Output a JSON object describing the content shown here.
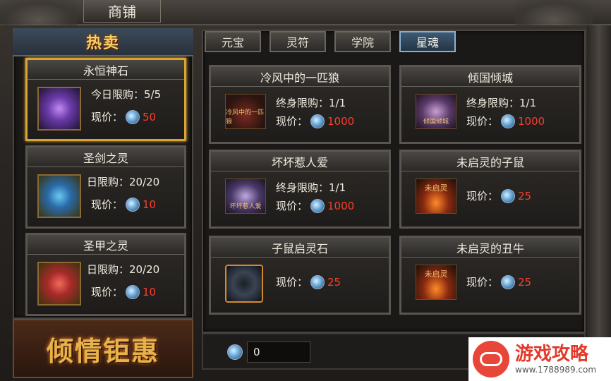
{
  "window": {
    "title": "商铺"
  },
  "hot": {
    "label": "热卖",
    "slogan": "倾情钜惠"
  },
  "left_items": [
    {
      "name": "永恒神石",
      "limit": "今日限购：5/5",
      "price_label": "现价：",
      "price": "50",
      "icon": "purple-crystal-icon"
    },
    {
      "name": "圣剑之灵",
      "limit": "日限购：20/20",
      "price_label": "现价：",
      "price": "10",
      "icon": "blue-orb-icon"
    },
    {
      "name": "圣甲之灵",
      "limit": "日限购：20/20",
      "price_label": "现价：",
      "price": "10",
      "icon": "red-orb-icon"
    }
  ],
  "tabs": [
    {
      "label": "元宝"
    },
    {
      "label": "灵符"
    },
    {
      "label": "学院"
    },
    {
      "label": "星魂"
    }
  ],
  "active_tab": "星魂",
  "grid_items": [
    {
      "name": "冷风中的一匹狼",
      "limit": "终身限购：1/1",
      "price_label": "现价：",
      "price": "1000",
      "thumb_text": "冷风中的一匹狼"
    },
    {
      "name": "倾国倾城",
      "limit": "终身限购：1/1",
      "price_label": "现价：",
      "price": "1000",
      "thumb_text": "倾国倾城"
    },
    {
      "name": "坏坏惹人爱",
      "limit": "终身限购：1/1",
      "price_label": "现价：",
      "price": "1000",
      "thumb_text": "坏坏惹人爱"
    },
    {
      "name": "未启灵的子鼠",
      "price_label": "现价：",
      "price": "25",
      "thumb_text": "未启灵"
    },
    {
      "name": "子鼠启灵石",
      "price_label": "现价：",
      "price": "25",
      "thumb_text": ""
    },
    {
      "name": "未启灵的丑牛",
      "price_label": "现价：",
      "price": "25",
      "thumb_text": "未启灵"
    }
  ],
  "balance": {
    "value": "0"
  },
  "watermark": {
    "title": "游戏攻略",
    "url": "www.1788989.com"
  },
  "colors": {
    "price": "#ff3b2a",
    "selected_border": "#d9a431",
    "active_tab": "#3f5a72"
  }
}
